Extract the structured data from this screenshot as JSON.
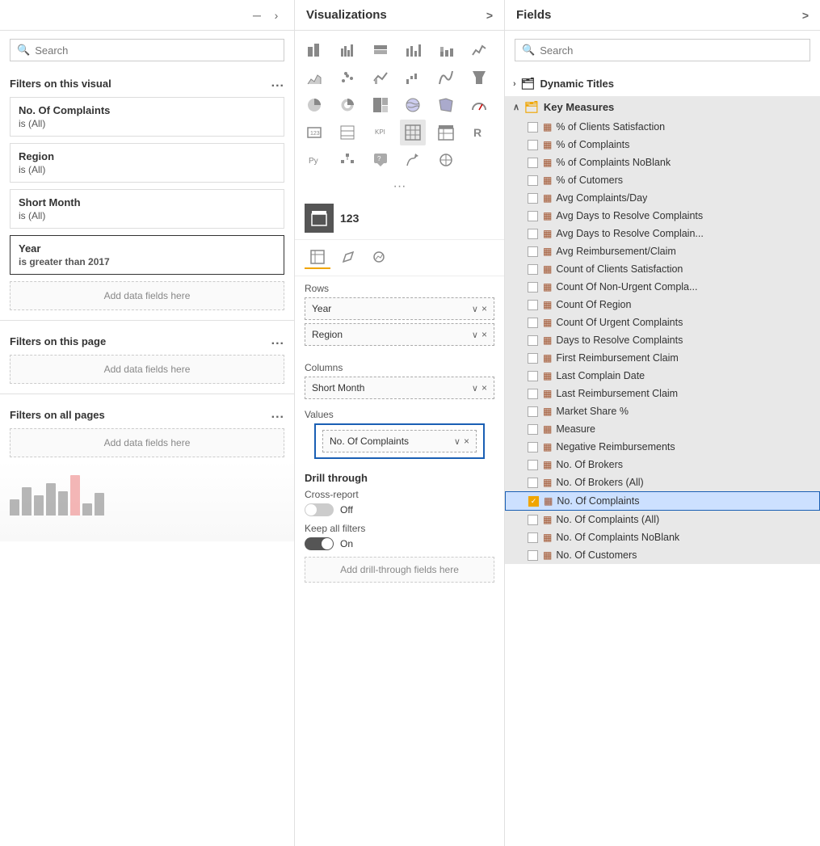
{
  "filters_panel": {
    "search_placeholder": "Search",
    "filters_on_this_visual": "Filters on this visual",
    "filters_on_this_page": "Filters on this page",
    "filters_on_all_pages": "Filters on all pages",
    "dots": "...",
    "add_data_here": "Add data fields here",
    "filter_cards": [
      {
        "title": "No. Of Complaints",
        "value": "is (All)",
        "active": false
      },
      {
        "title": "Region",
        "value": "is (All)",
        "active": false
      },
      {
        "title": "Short Month",
        "value": "is (All)",
        "active": false
      },
      {
        "title": "Year",
        "value": "is greater than 2017",
        "active": true
      }
    ]
  },
  "viz_panel": {
    "header": "Visualizations",
    "chevron": ">",
    "selected_number": "123",
    "rows_label": "Rows",
    "columns_label": "Columns",
    "values_label": "Values",
    "rows_fields": [
      {
        "label": "Year"
      },
      {
        "label": "Region"
      }
    ],
    "columns_fields": [
      {
        "label": "Short Month"
      }
    ],
    "values_fields": [
      {
        "label": "No. Of Complaints"
      }
    ],
    "drill_through": {
      "title": "Drill through",
      "cross_report_label": "Cross-report",
      "cross_report_state": "Off",
      "keep_filters_label": "Keep all filters",
      "keep_filters_state": "On",
      "add_drill": "Add drill-through fields here"
    }
  },
  "fields_panel": {
    "header": "Fields",
    "chevron": ">",
    "search_placeholder": "Search",
    "groups": [
      {
        "label": "Dynamic Titles",
        "expanded": false,
        "icon": "table"
      },
      {
        "label": "Key Measures",
        "expanded": true,
        "icon": "table-key"
      }
    ],
    "key_measures_items": [
      {
        "label": "% of Clients Satisfaction",
        "checked": false
      },
      {
        "label": "% of Complaints",
        "checked": false
      },
      {
        "label": "% of Complaints NoBlank",
        "checked": false
      },
      {
        "label": "% of Cutomers",
        "checked": false
      },
      {
        "label": "Avg Complaints/Day",
        "checked": false
      },
      {
        "label": "Avg Days to Resolve Complaints",
        "checked": false
      },
      {
        "label": "Avg Days to Resolve Complain...",
        "checked": false
      },
      {
        "label": "Avg Reimbursement/Claim",
        "checked": false
      },
      {
        "label": "Count of Clients Satisfaction",
        "checked": false
      },
      {
        "label": "Count Of Non-Urgent Compla...",
        "checked": false
      },
      {
        "label": "Count Of Region",
        "checked": false
      },
      {
        "label": "Count Of Urgent Complaints",
        "checked": false
      },
      {
        "label": "Days to Resolve Complaints",
        "checked": false
      },
      {
        "label": "First Reimbursement Claim",
        "checked": false
      },
      {
        "label": "Last Complain Date",
        "checked": false
      },
      {
        "label": "Last Reimbursement Claim",
        "checked": false
      },
      {
        "label": "Market Share %",
        "checked": false
      },
      {
        "label": "Measure",
        "checked": false
      },
      {
        "label": "Negative Reimbursements",
        "checked": false
      },
      {
        "label": "No. Of Brokers",
        "checked": false
      },
      {
        "label": "No. Of Brokers (All)",
        "checked": false
      },
      {
        "label": "No. Of Complaints",
        "checked": true,
        "selected": true
      },
      {
        "label": "No. Of Complaints (All)",
        "checked": false
      },
      {
        "label": "No. Of Complaints NoBlank",
        "checked": false
      },
      {
        "label": "No. Of Customers",
        "checked": false
      }
    ]
  },
  "icons": {
    "search": "🔍",
    "chevron_right": "›",
    "chevron_down": "∨",
    "chevron_up": "∧",
    "x_mark": "×",
    "check": "✓",
    "expand_v": "∨",
    "collapse": "∧"
  }
}
